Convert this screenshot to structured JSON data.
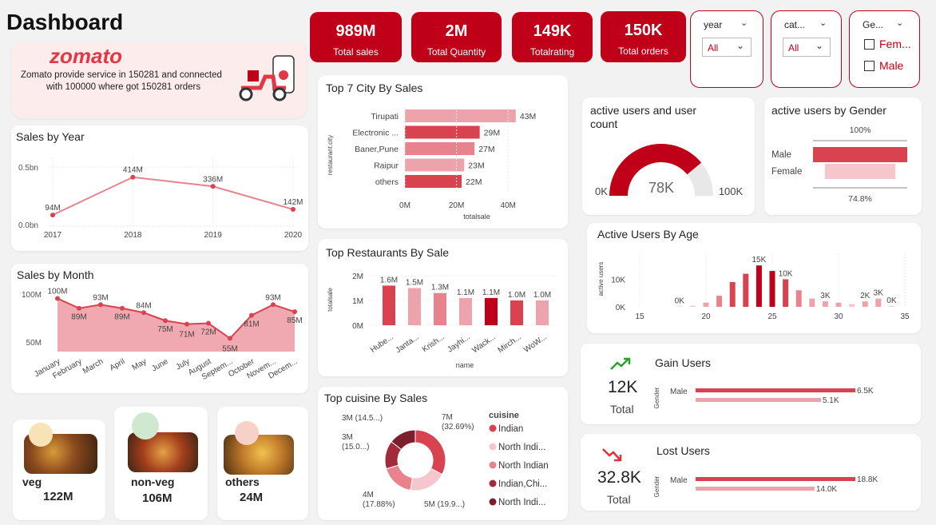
{
  "page": {
    "title": "Dashboard"
  },
  "brand": {
    "logo": "zomato",
    "caption_line1": "Zomato provide service in 150281 and connected",
    "caption_line2": "with 100000 where got 150281 orders",
    "color": "#e23744"
  },
  "kpis": [
    {
      "value": "989M",
      "label": "Total sales"
    },
    {
      "value": "2M",
      "label": "Total Quantity"
    },
    {
      "value": "149K",
      "label": "Totalrating"
    },
    {
      "value": "150K",
      "label": "Total orders"
    }
  ],
  "slicers": {
    "year": {
      "title": "year",
      "value": "All"
    },
    "category": {
      "title": "cat...",
      "value": "All"
    },
    "gender": {
      "title": "Ge...",
      "options": [
        "Fem...",
        "Male"
      ]
    }
  },
  "colors": {
    "primary": "#c00018",
    "dark": "#7a1f2b",
    "mid": "#d9434f",
    "light": "#eda3ab",
    "pale": "#f5c6cb",
    "line": "#e8838d"
  },
  "food": [
    {
      "label": "veg",
      "value": "122M",
      "icon": "veg-dish-icon"
    },
    {
      "label": "non-veg",
      "value": "106M",
      "icon": "salad-bowl-icon"
    },
    {
      "label": "others",
      "value": "24M",
      "icon": "burger-icon"
    }
  ],
  "gain_users": {
    "title": "Gain Users",
    "value": "12K",
    "sub": "Total",
    "axis_label": "Gender",
    "category": "Male",
    "labels": [
      "6.5K",
      "5.1K"
    ],
    "icon": "trend-up-icon"
  },
  "lost_users": {
    "title": "Lost Users",
    "value": "32.8K",
    "sub": "Total",
    "axis_label": "Gender",
    "category": "Male",
    "labels": [
      "18.8K",
      "14.0K"
    ],
    "icon": "trend-down-icon"
  },
  "chart_data": [
    {
      "id": "sales_by_year",
      "type": "line",
      "title": "Sales by Year",
      "x": [
        "2017",
        "2018",
        "2019",
        "2020"
      ],
      "values": [
        94,
        414,
        336,
        142
      ],
      "labels": [
        "94M",
        "414M",
        "336M",
        "142M"
      ],
      "yticks": [
        "0.5bn",
        "0.0bn"
      ],
      "ylim": [
        0,
        500
      ]
    },
    {
      "id": "sales_by_month",
      "type": "area",
      "title": "Sales by Month",
      "x": [
        "January",
        "February",
        "March",
        "April",
        "May",
        "June",
        "July",
        "August",
        "Septem...",
        "October",
        "Novem...",
        "Decem..."
      ],
      "values": [
        100,
        89,
        93,
        89,
        84,
        75,
        71,
        72,
        55,
        81,
        93,
        85
      ],
      "labels": [
        "100M",
        "89M",
        "93M",
        "89M",
        "84M",
        "75M",
        "71M",
        "72M",
        "55M",
        "81M",
        "93M",
        "85M"
      ],
      "yticks": [
        "100M",
        "50M"
      ],
      "ylim": [
        40,
        105
      ]
    },
    {
      "id": "top_city",
      "type": "bar",
      "orientation": "horizontal",
      "title": "Top 7 City By Sales",
      "categories": [
        "Tirupati",
        "Electronic ...",
        "Baner,Pune",
        "Raipur",
        "others"
      ],
      "values": [
        43,
        29,
        27,
        23,
        22
      ],
      "labels": [
        "43M",
        "29M",
        "27M",
        "23M",
        "22M"
      ],
      "xticks": [
        "0M",
        "20M",
        "40M"
      ],
      "xlabel": "totalsale",
      "ylabel": "restaurant.city",
      "xlim": [
        0,
        48
      ]
    },
    {
      "id": "top_restaurants",
      "type": "bar",
      "title": "Top Restaurants By Sale",
      "categories": [
        "Hube...",
        "Janta...",
        "Krish...",
        "Jayhi...",
        "Wack...",
        "Mirch...",
        "WoW..."
      ],
      "values": [
        1.6,
        1.5,
        1.3,
        1.1,
        1.1,
        1.0,
        1.0
      ],
      "labels": [
        "1.6M",
        "1.5M",
        "1.3M",
        "1.1M",
        "1.1M",
        "1.0M",
        "1.0M"
      ],
      "yticks": [
        "2M",
        "1M",
        "0M"
      ],
      "xlabel": "name",
      "ylabel": "totalsale",
      "ylim": [
        0,
        2
      ]
    },
    {
      "id": "top_cuisine",
      "type": "pie",
      "title": "Top cuisine By Sales",
      "legend_title": "cuisine",
      "legend": [
        "Indian",
        "North Indi...",
        "North Indian",
        "Indian,Chi...",
        "North Indi..."
      ],
      "values": [
        32.69,
        19.9,
        17.88,
        15.0,
        14.5
      ],
      "labels": [
        "7M\n(32.69%)",
        "5M (19.9...)",
        "4M\n(17.88%)",
        "3M\n(15.0...)",
        "3M (14.5...)"
      ]
    },
    {
      "id": "active_users_gauge",
      "type": "gauge",
      "title": "active users and user count",
      "value": 78,
      "value_label": "78K",
      "min_label": "0K",
      "max_label": "100K",
      "range": [
        0,
        100
      ]
    },
    {
      "id": "active_users_gender",
      "type": "bar",
      "orientation": "funnel",
      "title": "active users by Gender",
      "categories": [
        "Male",
        "Female"
      ],
      "values": [
        100,
        74.8
      ],
      "top_label": "100%",
      "bottom_label": "74.8%"
    },
    {
      "id": "active_users_age",
      "type": "bar",
      "title": "Active Users By Age",
      "ylabel": "active users",
      "yticks": [
        "10K",
        "0K"
      ],
      "xticks": [
        "15",
        "20",
        "25",
        "30",
        "35"
      ],
      "xlim": [
        15,
        35
      ],
      "ylim": [
        0,
        16.5
      ],
      "x": [
        18,
        19,
        20,
        21,
        22,
        23,
        24,
        25,
        26,
        27,
        28,
        29,
        30,
        31,
        32,
        33,
        34
      ],
      "values": [
        0.2,
        0.4,
        1.5,
        4,
        9,
        12,
        15,
        13,
        10,
        6,
        3,
        2,
        1.5,
        1,
        2,
        3,
        0.3
      ],
      "labels": {
        "18": "0K",
        "24": "15K",
        "26": "10K",
        "29": "3K",
        "32": "2K",
        "33": "3K",
        "34": "0K"
      }
    }
  ]
}
